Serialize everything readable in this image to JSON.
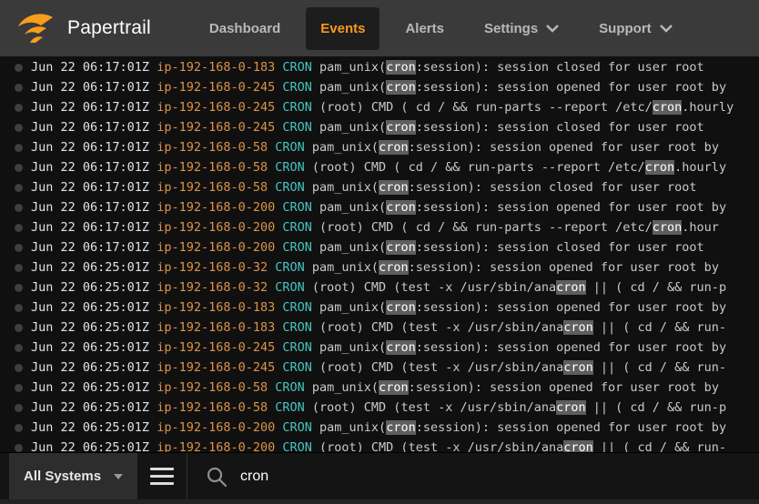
{
  "header": {
    "brand": "Papertrail",
    "nav": [
      {
        "label": "Dashboard",
        "active": false,
        "dropdown": false
      },
      {
        "label": "Events",
        "active": true,
        "dropdown": false
      },
      {
        "label": "Alerts",
        "active": false,
        "dropdown": false
      },
      {
        "label": "Settings",
        "active": false,
        "dropdown": true
      },
      {
        "label": "Support",
        "active": false,
        "dropdown": true
      }
    ]
  },
  "colors": {
    "brand_orange": "#f8981d",
    "host_orange": "#dd9447",
    "program_teal": "#45c5c0",
    "highlight_bg": "#5e5e5e",
    "header_bg": "#3a3a3a"
  },
  "log": {
    "highlight_term": "cron",
    "rows": [
      {
        "timestamp": "Jun 22 06:17:01Z",
        "host": "ip-192-168-0-183",
        "program": "CRON",
        "message": "pam_unix(cron:session): session closed for user root"
      },
      {
        "timestamp": "Jun 22 06:17:01Z",
        "host": "ip-192-168-0-245",
        "program": "CRON",
        "message": "pam_unix(cron:session): session opened for user root by"
      },
      {
        "timestamp": "Jun 22 06:17:01Z",
        "host": "ip-192-168-0-245",
        "program": "CRON",
        "message": "(root) CMD ( cd / && run-parts --report /etc/cron.hourly"
      },
      {
        "timestamp": "Jun 22 06:17:01Z",
        "host": "ip-192-168-0-245",
        "program": "CRON",
        "message": "pam_unix(cron:session): session closed for user root"
      },
      {
        "timestamp": "Jun 22 06:17:01Z",
        "host": "ip-192-168-0-58",
        "program": "CRON",
        "message": "pam_unix(cron:session): session opened for user root by"
      },
      {
        "timestamp": "Jun 22 06:17:01Z",
        "host": "ip-192-168-0-58",
        "program": "CRON",
        "message": "(root) CMD ( cd / && run-parts --report /etc/cron.hourly"
      },
      {
        "timestamp": "Jun 22 06:17:01Z",
        "host": "ip-192-168-0-58",
        "program": "CRON",
        "message": "pam_unix(cron:session): session closed for user root"
      },
      {
        "timestamp": "Jun 22 06:17:01Z",
        "host": "ip-192-168-0-200",
        "program": "CRON",
        "message": "pam_unix(cron:session): session opened for user root by"
      },
      {
        "timestamp": "Jun 22 06:17:01Z",
        "host": "ip-192-168-0-200",
        "program": "CRON",
        "message": "(root) CMD ( cd / && run-parts --report /etc/cron.hour"
      },
      {
        "timestamp": "Jun 22 06:17:01Z",
        "host": "ip-192-168-0-200",
        "program": "CRON",
        "message": "pam_unix(cron:session): session closed for user root"
      },
      {
        "timestamp": "Jun 22 06:25:01Z",
        "host": "ip-192-168-0-32",
        "program": "CRON",
        "message": "pam_unix(cron:session): session opened for user root by"
      },
      {
        "timestamp": "Jun 22 06:25:01Z",
        "host": "ip-192-168-0-32",
        "program": "CRON",
        "message": "(root) CMD (test -x /usr/sbin/anacron || ( cd / && run-p"
      },
      {
        "timestamp": "Jun 22 06:25:01Z",
        "host": "ip-192-168-0-183",
        "program": "CRON",
        "message": "pam_unix(cron:session): session opened for user root by"
      },
      {
        "timestamp": "Jun 22 06:25:01Z",
        "host": "ip-192-168-0-183",
        "program": "CRON",
        "message": "(root) CMD (test -x /usr/sbin/anacron || ( cd / && run-"
      },
      {
        "timestamp": "Jun 22 06:25:01Z",
        "host": "ip-192-168-0-245",
        "program": "CRON",
        "message": "pam_unix(cron:session): session opened for user root by"
      },
      {
        "timestamp": "Jun 22 06:25:01Z",
        "host": "ip-192-168-0-245",
        "program": "CRON",
        "message": "(root) CMD (test -x /usr/sbin/anacron || ( cd / && run-"
      },
      {
        "timestamp": "Jun 22 06:25:01Z",
        "host": "ip-192-168-0-58",
        "program": "CRON",
        "message": "pam_unix(cron:session): session opened for user root by"
      },
      {
        "timestamp": "Jun 22 06:25:01Z",
        "host": "ip-192-168-0-58",
        "program": "CRON",
        "message": "(root) CMD (test -x /usr/sbin/anacron || ( cd / && run-p"
      },
      {
        "timestamp": "Jun 22 06:25:01Z",
        "host": "ip-192-168-0-200",
        "program": "CRON",
        "message": "pam_unix(cron:session): session opened for user root by"
      },
      {
        "timestamp": "Jun 22 06:25:01Z",
        "host": "ip-192-168-0-200",
        "program": "CRON",
        "message": "(root) CMD (test -x /usr/sbin/anacron || ( cd / && run-"
      }
    ]
  },
  "footer": {
    "systems_selector_label": "All Systems",
    "search": {
      "value": "cron",
      "placeholder": ""
    }
  }
}
